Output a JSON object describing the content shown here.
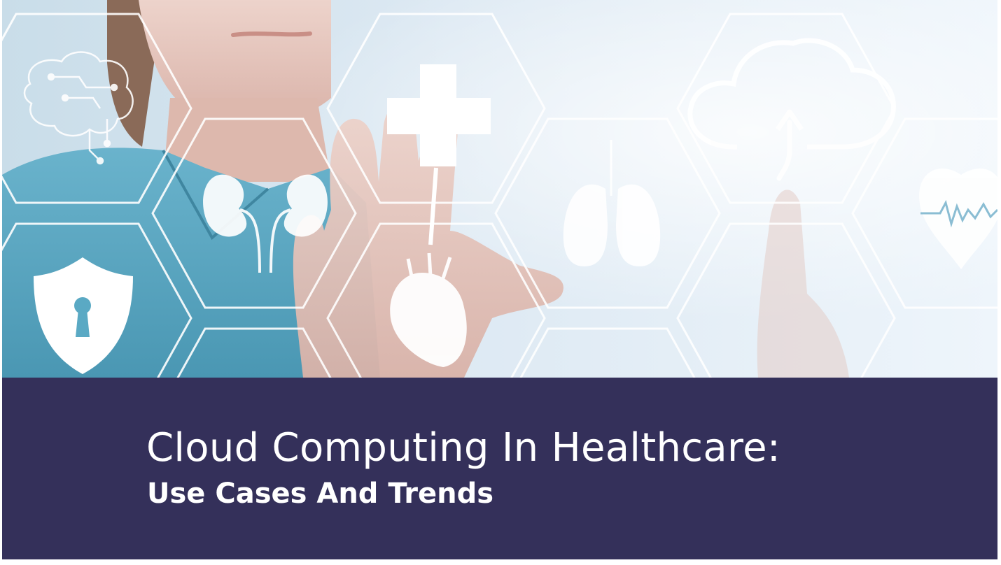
{
  "banner": {
    "title": "Cloud Computing In Healthcare:",
    "subtitle": "Use Cases And Trends",
    "background_color": "#34305a",
    "text_color": "#ffffff"
  },
  "hero": {
    "icons": [
      "brain-circuit-icon",
      "kidney-icon",
      "medical-cross-icon",
      "lungs-icon",
      "cloud-upload-icon",
      "heart-pulse-icon",
      "shield-lock-icon",
      "anatomical-heart-icon"
    ],
    "colors": {
      "sky": "#e8f1fa",
      "scrubs": "#5aa9c4",
      "skin": "#e6c4bb"
    }
  }
}
